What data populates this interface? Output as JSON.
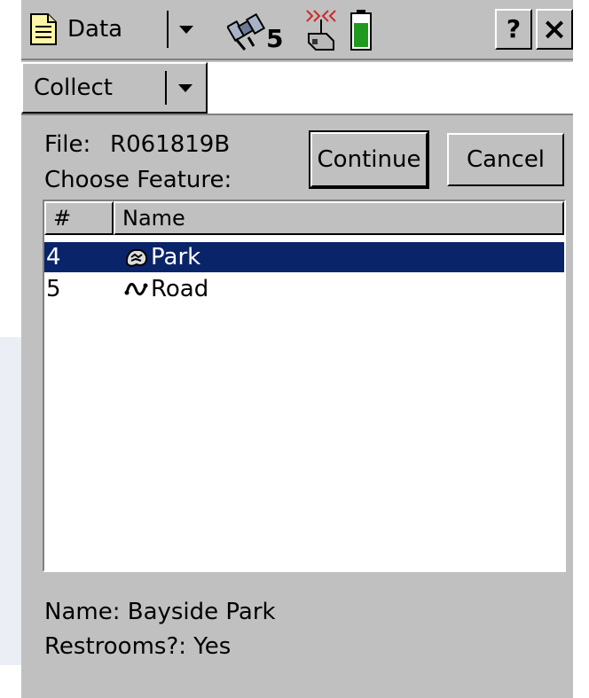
{
  "header": {
    "app_menu_label": "Data",
    "satellite_count": "5",
    "help_label": "?",
    "close_label": "×"
  },
  "mode_menu": {
    "label": "Collect"
  },
  "form": {
    "file_label": "File:",
    "file_value": "R061819B",
    "choose_feature_label": "Choose Feature:",
    "continue_label": "Continue",
    "cancel_label": "Cancel"
  },
  "feature_list": {
    "columns": [
      "#",
      "Name"
    ],
    "rows": [
      {
        "num": "4",
        "name": "Park",
        "icon": "area-feature-icon",
        "selected": true
      },
      {
        "num": "5",
        "name": "Road",
        "icon": "line-feature-icon",
        "selected": false
      }
    ]
  },
  "details": {
    "name_line": "Name: Bayside Park",
    "restrooms_line": "Restrooms?: Yes"
  },
  "colors": {
    "selection": "#0a246a",
    "battery": "#1f9a1f",
    "signal": "#cc2a2a"
  }
}
